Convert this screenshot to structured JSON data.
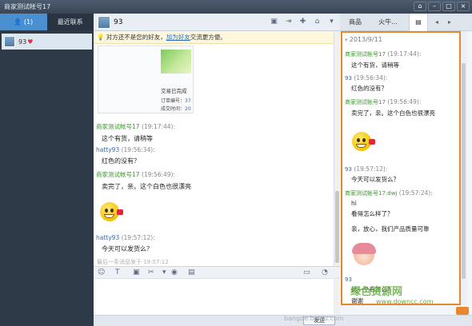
{
  "window": {
    "title": "商家测试帐号17",
    "controls": [
      "pin",
      "min",
      "max",
      "close"
    ]
  },
  "left": {
    "tabs": [
      {
        "label": "(1)",
        "active": true
      },
      {
        "label": "最近联系",
        "active": false
      }
    ],
    "contact": {
      "name": "93"
    }
  },
  "chat": {
    "name": "93",
    "notice": {
      "prefix": "对方还不是您的好友，",
      "link": "加为好友",
      "suffix": "交流更方便。"
    },
    "order": {
      "status": "交易已完成",
      "id_label": "订单编号：",
      "id_val": "37",
      "score_label": "成交时间：",
      "score_val": "20"
    },
    "messages": [
      {
        "sender": "商家测试帐号17",
        "time": "(19:17:44):",
        "text": "这个有货，请稍等"
      },
      {
        "sender": "hatty93",
        "time": "(19:56:34):",
        "text": "红色的没有？"
      },
      {
        "sender": "商家测试帐号17",
        "time": "(19:56:49):",
        "text": "卖完了，亲。这个白色也很漂亮"
      },
      {
        "sender": "hatty93",
        "time": "(19:57:12):",
        "text": "今天可以发货么？"
      }
    ],
    "last_msg": "最后一条消息发于 19:57:12",
    "send_label": "发送"
  },
  "right": {
    "tabs": [
      "商品",
      "火牛...",
      "▤"
    ],
    "date": "2013/9/11",
    "messages": [
      {
        "sender": "商家测试帐号17",
        "time": "(19:17:44):",
        "text": "这个有货，请稍等"
      },
      {
        "sender": "93",
        "time": "(19:56:34):",
        "text": "红色的没有？"
      },
      {
        "sender": "商家测试帐号17",
        "time": "(19:56:49):",
        "text": "卖完了，亲。这个白色也很漂亮"
      },
      {
        "sender": "93",
        "time": "(19:57:12):",
        "text": "今天可以发货么？"
      },
      {
        "sender": "商家测试帐号17:dwj",
        "time": "(19:57:24):",
        "text": "hi",
        "text2": "看得怎么样了？",
        "text3": "亲，放心，我们产品质量可靠"
      },
      {
        "sender": "93",
        "time": "",
        "text": "这一个有货么？",
        "text2": "谢谢"
      }
    ]
  },
  "watermark": {
    "line1": "绿色资源网",
    "line2": "www.downcc.com",
    "line3": "bangde.baidu.com"
  },
  "colors": {
    "titlebar": "#3d4a5c",
    "highlight": "#e8872b",
    "green_sender": "#3a9a2a",
    "blue_sender": "#2a6ec0"
  }
}
